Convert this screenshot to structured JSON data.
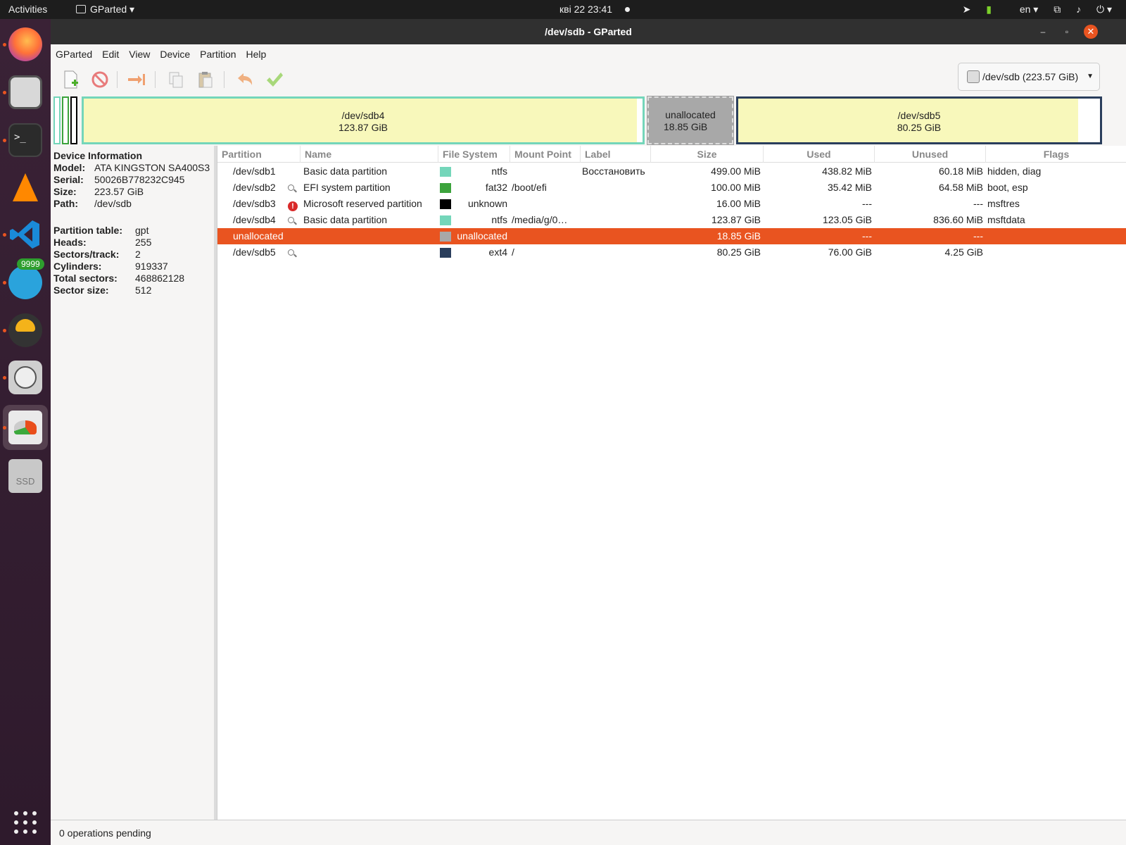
{
  "topbar": {
    "activities": "Activities",
    "app_name": "GParted",
    "clock": "кві 22  23:41",
    "lang": "en"
  },
  "dock": {
    "telegram_badge": "9999",
    "ssd_label": "SSD"
  },
  "window": {
    "title": "/dev/sdb - GParted",
    "close": "✕",
    "maximize": "▫",
    "minimize": "–"
  },
  "menu": {
    "gparted": "GParted",
    "edit": "Edit",
    "view": "View",
    "device": "Device",
    "partition": "Partition",
    "help": "Help"
  },
  "device_selector": {
    "value": "/dev/sdb (223.57 GiB)"
  },
  "diskmap": {
    "sdb4": {
      "name": "/dev/sdb4",
      "size": "123.87 GiB"
    },
    "unallocated": {
      "name": "unallocated",
      "size": "18.85 GiB"
    },
    "sdb5": {
      "name": "/dev/sdb5",
      "size": "80.25 GiB"
    }
  },
  "device_info": {
    "title": "Device Information",
    "model_label": "Model:",
    "model": "ATA KINGSTON SA400S3",
    "serial_label": "Serial:",
    "serial": "50026B778232C945",
    "size_label": "Size:",
    "size": "223.57 GiB",
    "path_label": "Path:",
    "path": "/dev/sdb",
    "ptable_label": "Partition table:",
    "ptable": "gpt",
    "heads_label": "Heads:",
    "heads": "255",
    "sectors_label": "Sectors/track:",
    "sectors": "2",
    "cylinders_label": "Cylinders:",
    "cylinders": "919337",
    "total_label": "Total sectors:",
    "total": "468862128",
    "sector_size_label": "Sector size:",
    "sector_size": "512"
  },
  "table": {
    "columns": [
      "Partition",
      "Name",
      "File System",
      "Mount Point",
      "Label",
      "Size",
      "Used",
      "Unused",
      "Flags"
    ],
    "rows": [
      {
        "partition": "/dev/sdb1",
        "icon": "",
        "name": "Basic data partition",
        "fs_color": "#74d6ba",
        "fs": "ntfs",
        "mount": "",
        "label": "Восстановить",
        "size": "499.00 MiB",
        "used": "438.82 MiB",
        "unused": "60.18 MiB",
        "flags": "hidden, diag"
      },
      {
        "partition": "/dev/sdb2",
        "icon": "magnifier-icon",
        "name": "EFI system partition",
        "fs_color": "#3ca33c",
        "fs": "fat32",
        "mount": "/boot/efi",
        "label": "",
        "size": "100.00 MiB",
        "used": "35.42 MiB",
        "unused": "64.58 MiB",
        "flags": "boot, esp"
      },
      {
        "partition": "/dev/sdb3",
        "icon": "warning-icon",
        "name": "Microsoft reserved partition",
        "fs_color": "#000000",
        "fs": "unknown",
        "mount": "",
        "label": "",
        "size": "16.00 MiB",
        "used": "---",
        "unused": "---",
        "flags": "msftres"
      },
      {
        "partition": "/dev/sdb4",
        "icon": "magnifier-icon",
        "name": "Basic data partition",
        "fs_color": "#74d6ba",
        "fs": "ntfs",
        "mount": "/media/g/0…",
        "label": "",
        "size": "123.87 GiB",
        "used": "123.05 GiB",
        "unused": "836.60 MiB",
        "flags": "msftdata"
      },
      {
        "partition": "unallocated",
        "icon": "",
        "name": "",
        "fs_color": "#a8a8a8",
        "fs": "unallocated",
        "mount": "",
        "label": "",
        "size": "18.85 GiB",
        "used": "---",
        "unused": "---",
        "flags": ""
      },
      {
        "partition": "/dev/sdb5",
        "icon": "magnifier-icon",
        "name": "",
        "fs_color": "#2a3e5c",
        "fs": "ext4",
        "mount": "/",
        "label": "",
        "size": "80.25 GiB",
        "used": "76.00 GiB",
        "unused": "4.25 GiB",
        "flags": ""
      }
    ],
    "selected_row": 4
  },
  "status": {
    "text": "0 operations pending"
  },
  "colors": {
    "accent": "#e95420",
    "ntfs": "#74d6ba",
    "fat32": "#3ca33c",
    "ext4": "#2a3e5c",
    "unallocated": "#a8a8a8",
    "used_fill": "#f8f8bb"
  }
}
